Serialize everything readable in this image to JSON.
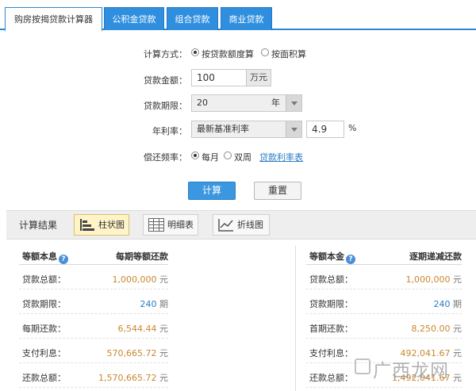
{
  "tabs": [
    {
      "label": "购房按揭贷款计算器",
      "active": true
    },
    {
      "label": "公积金贷款",
      "active": false
    },
    {
      "label": "组合贷款",
      "active": false
    },
    {
      "label": "商业贷款",
      "active": false
    }
  ],
  "form": {
    "calc_method": {
      "label": "计算方式：",
      "options": [
        {
          "label": "按贷款额度算",
          "checked": true
        },
        {
          "label": "按面积算",
          "checked": false
        }
      ]
    },
    "amount": {
      "label": "贷款金额：",
      "value": "100",
      "unit": "万元"
    },
    "term": {
      "label": "贷款期限：",
      "value": "20",
      "unit": "年"
    },
    "rate": {
      "label": "年利率：",
      "selected": "最新基准利率",
      "value": "4.9",
      "unit": "%"
    },
    "frequency": {
      "label": "偿还频率：",
      "options": [
        {
          "label": "每月",
          "checked": true
        },
        {
          "label": "双周",
          "checked": false
        }
      ],
      "link": "贷款利率表"
    },
    "buttons": {
      "calculate": "计算",
      "reset": "重置"
    }
  },
  "results": {
    "title": "计算结果",
    "views": [
      {
        "label": "柱状图",
        "icon": "bar-chart-icon",
        "active": true
      },
      {
        "label": "明细表",
        "icon": "table-icon",
        "active": false
      },
      {
        "label": "折线图",
        "icon": "line-chart-icon",
        "active": false
      }
    ],
    "equal_payment": {
      "title": "等额本息",
      "subtitle": "每期等额还款",
      "rows": [
        {
          "label": "贷款总额：",
          "value": "1,000,000",
          "unit": "元"
        },
        {
          "label": "贷款期限：",
          "value": "240",
          "unit": "期"
        },
        {
          "label": "每期还款：",
          "value": "6,544.44",
          "unit": "元"
        },
        {
          "label": "支付利息：",
          "value": "570,665.72",
          "unit": "元"
        },
        {
          "label": "还款总额：",
          "value": "1,570,665.72",
          "unit": "元"
        }
      ]
    },
    "equal_principal": {
      "title": "等额本金",
      "subtitle": "逐期递减还款",
      "rows": [
        {
          "label": "贷款总额：",
          "value": "1,000,000",
          "unit": "元"
        },
        {
          "label": "贷款期限：",
          "value": "240",
          "unit": "期"
        },
        {
          "label": "首期还款：",
          "value": "8,250.00",
          "unit": "元"
        },
        {
          "label": "支付利息：",
          "value": "492,041.67",
          "unit": "元"
        },
        {
          "label": "还款总额：",
          "value": "1,492,041.67",
          "unit": "元"
        }
      ]
    }
  },
  "watermark": "广西龙网",
  "colors": {
    "accent": "#2a86d2",
    "value_orange": "#c9872e",
    "value_blue": "#2a7bc4"
  }
}
